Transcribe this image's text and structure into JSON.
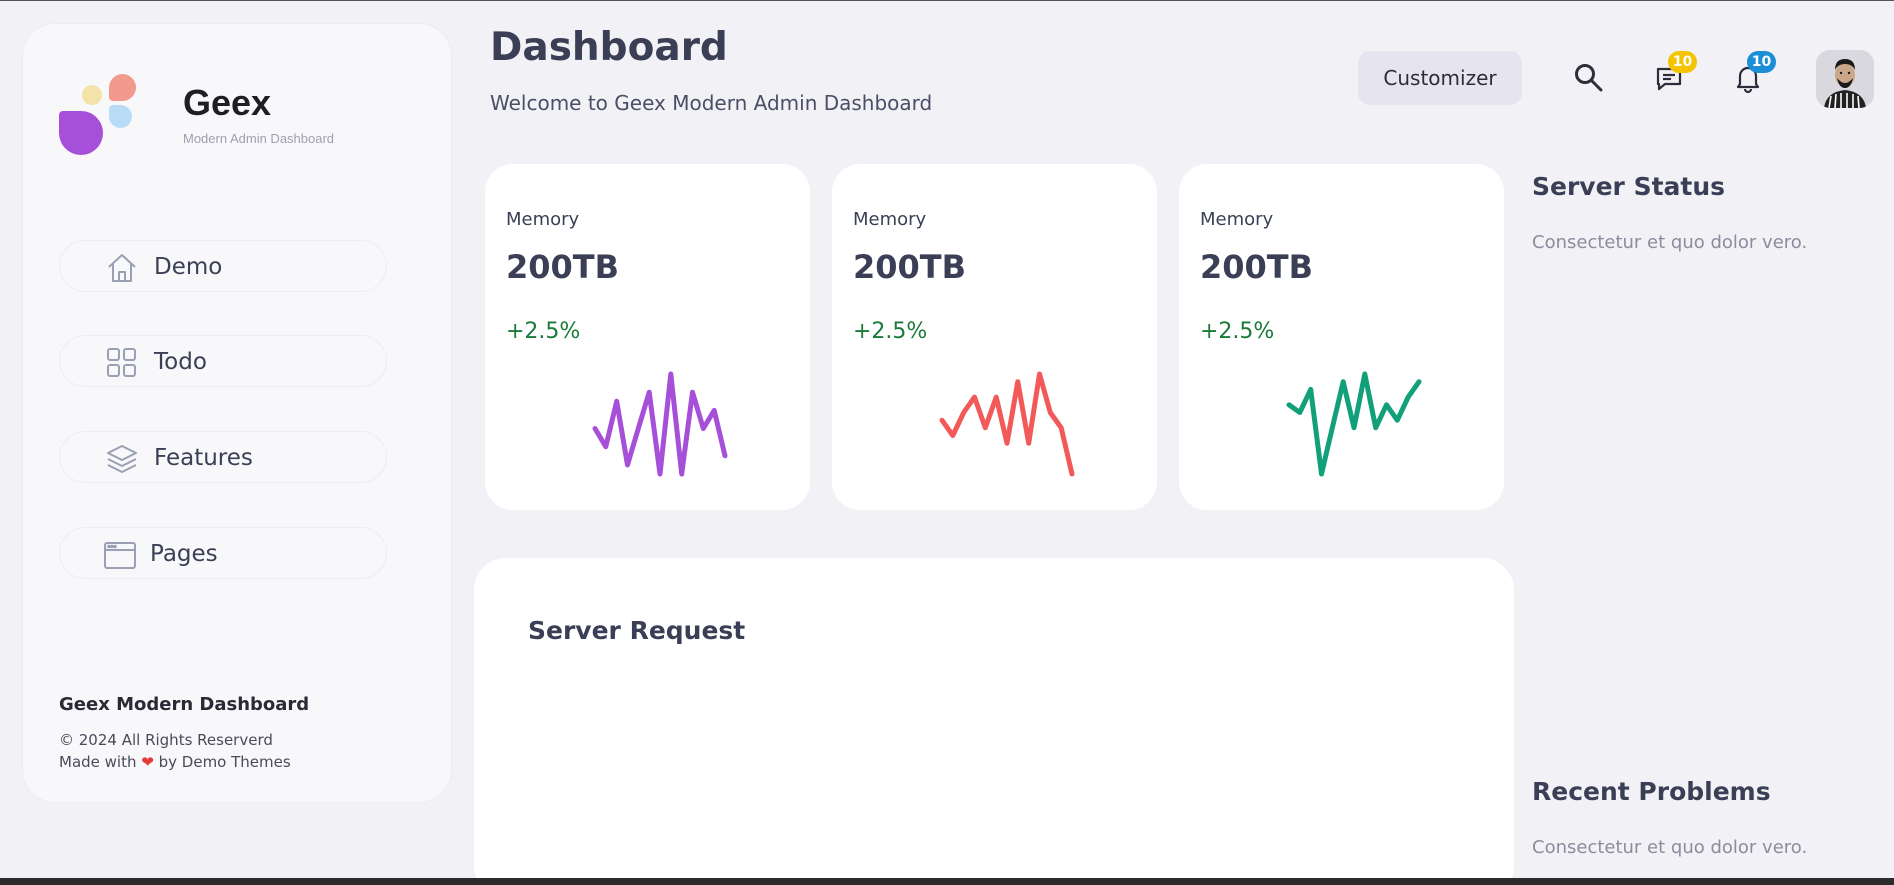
{
  "brand": {
    "name": "Geex",
    "tagline": "Modern Admin Dashboard"
  },
  "sidebar": {
    "items": [
      {
        "label": "Demo",
        "icon": "home-icon"
      },
      {
        "label": "Todo",
        "icon": "grid-icon"
      },
      {
        "label": "Features",
        "icon": "layers-icon"
      },
      {
        "label": "Pages",
        "icon": "browser-window-icon"
      }
    ],
    "footer": {
      "title": "Geex Modern Dashboard",
      "copyright": "© 2024 All Rights Reserverd",
      "made_prefix": "Made with",
      "heart": "❤",
      "made_suffix": "by Demo Themes"
    }
  },
  "header": {
    "title": "Dashboard",
    "subtitle": "Welcome to Geex Modern Admin Dashboard",
    "customizer_label": "Customizer",
    "messages_badge": "10",
    "notifications_badge": "10"
  },
  "stats": [
    {
      "label": "Memory",
      "value": "200TB",
      "change": "+2.5%",
      "color": "#a64fd8",
      "spark": [
        6,
        4,
        9,
        2,
        6,
        10,
        1,
        12,
        1,
        10,
        6,
        8,
        3
      ]
    },
    {
      "label": "Memory",
      "value": "200TB",
      "change": "+2.5%",
      "color": "#f25a5a",
      "spark": [
        7,
        5,
        8,
        10,
        6,
        10,
        4,
        12,
        4,
        13,
        8,
        6,
        0
      ]
    },
    {
      "label": "Memory",
      "value": "200TB",
      "change": "+2.5%",
      "color": "#12a07a",
      "spark": [
        9,
        8,
        11,
        0,
        6,
        12,
        6,
        13,
        6,
        9,
        7,
        10,
        12
      ]
    }
  ],
  "server_request": {
    "title": "Server Request"
  },
  "server_status": {
    "title": "Server Status",
    "text": "Consectetur et quo dolor vero."
  },
  "recent_problems": {
    "title": "Recent Problems",
    "text": "Consectetur et quo dolor vero."
  },
  "colors": {
    "accent_badge_yellow": "#f5c400",
    "accent_badge_blue": "#1b8fd6",
    "success": "#1a7a3a"
  }
}
